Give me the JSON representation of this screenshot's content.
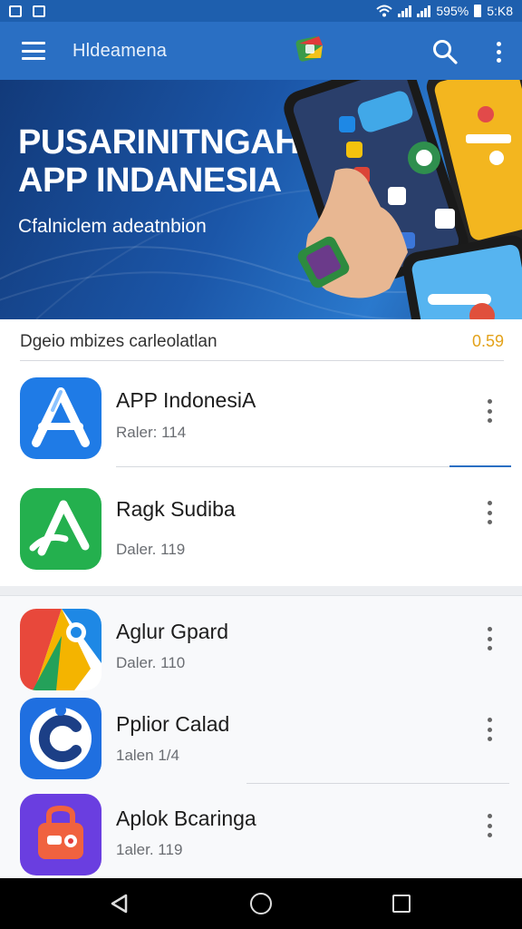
{
  "status_bar": {
    "battery": "595%",
    "time": "5:K8"
  },
  "app_bar": {
    "title": "Hldeamena"
  },
  "banner": {
    "headline_line1": "PUSARINITNGAH",
    "headline_line2": "APP INDANESIA",
    "subtitle": "Cfalniclem adeatnbion"
  },
  "section": {
    "title": "Dgeio mbizes carleolatlan",
    "badge": "0.59"
  },
  "apps": [
    {
      "name": "APP IndonesiA",
      "meta": "Raler: 114",
      "icon": "app-store-a-icon",
      "color": "#1f7be6"
    },
    {
      "name": "Ragk Sudiba",
      "meta": "Daler. 119",
      "icon": "green-a-icon",
      "color": "#24b04e"
    },
    {
      "name": "Aglur Gpard",
      "meta": "Daler. 110",
      "icon": "drive-triangle-icon",
      "color": "#f0b417"
    },
    {
      "name": "Pplior Calad",
      "meta": "1alen 1/4",
      "icon": "c-logo-icon",
      "color": "#1f6fe0"
    },
    {
      "name": "Aplok Bcaringa",
      "meta": "1aler. 119",
      "icon": "briefcase-icon",
      "color": "#6a3ee0"
    }
  ],
  "colors": {
    "status_bar": "#1e5fae",
    "app_bar": "#2a6fc3",
    "accent": "#e3a21a"
  }
}
